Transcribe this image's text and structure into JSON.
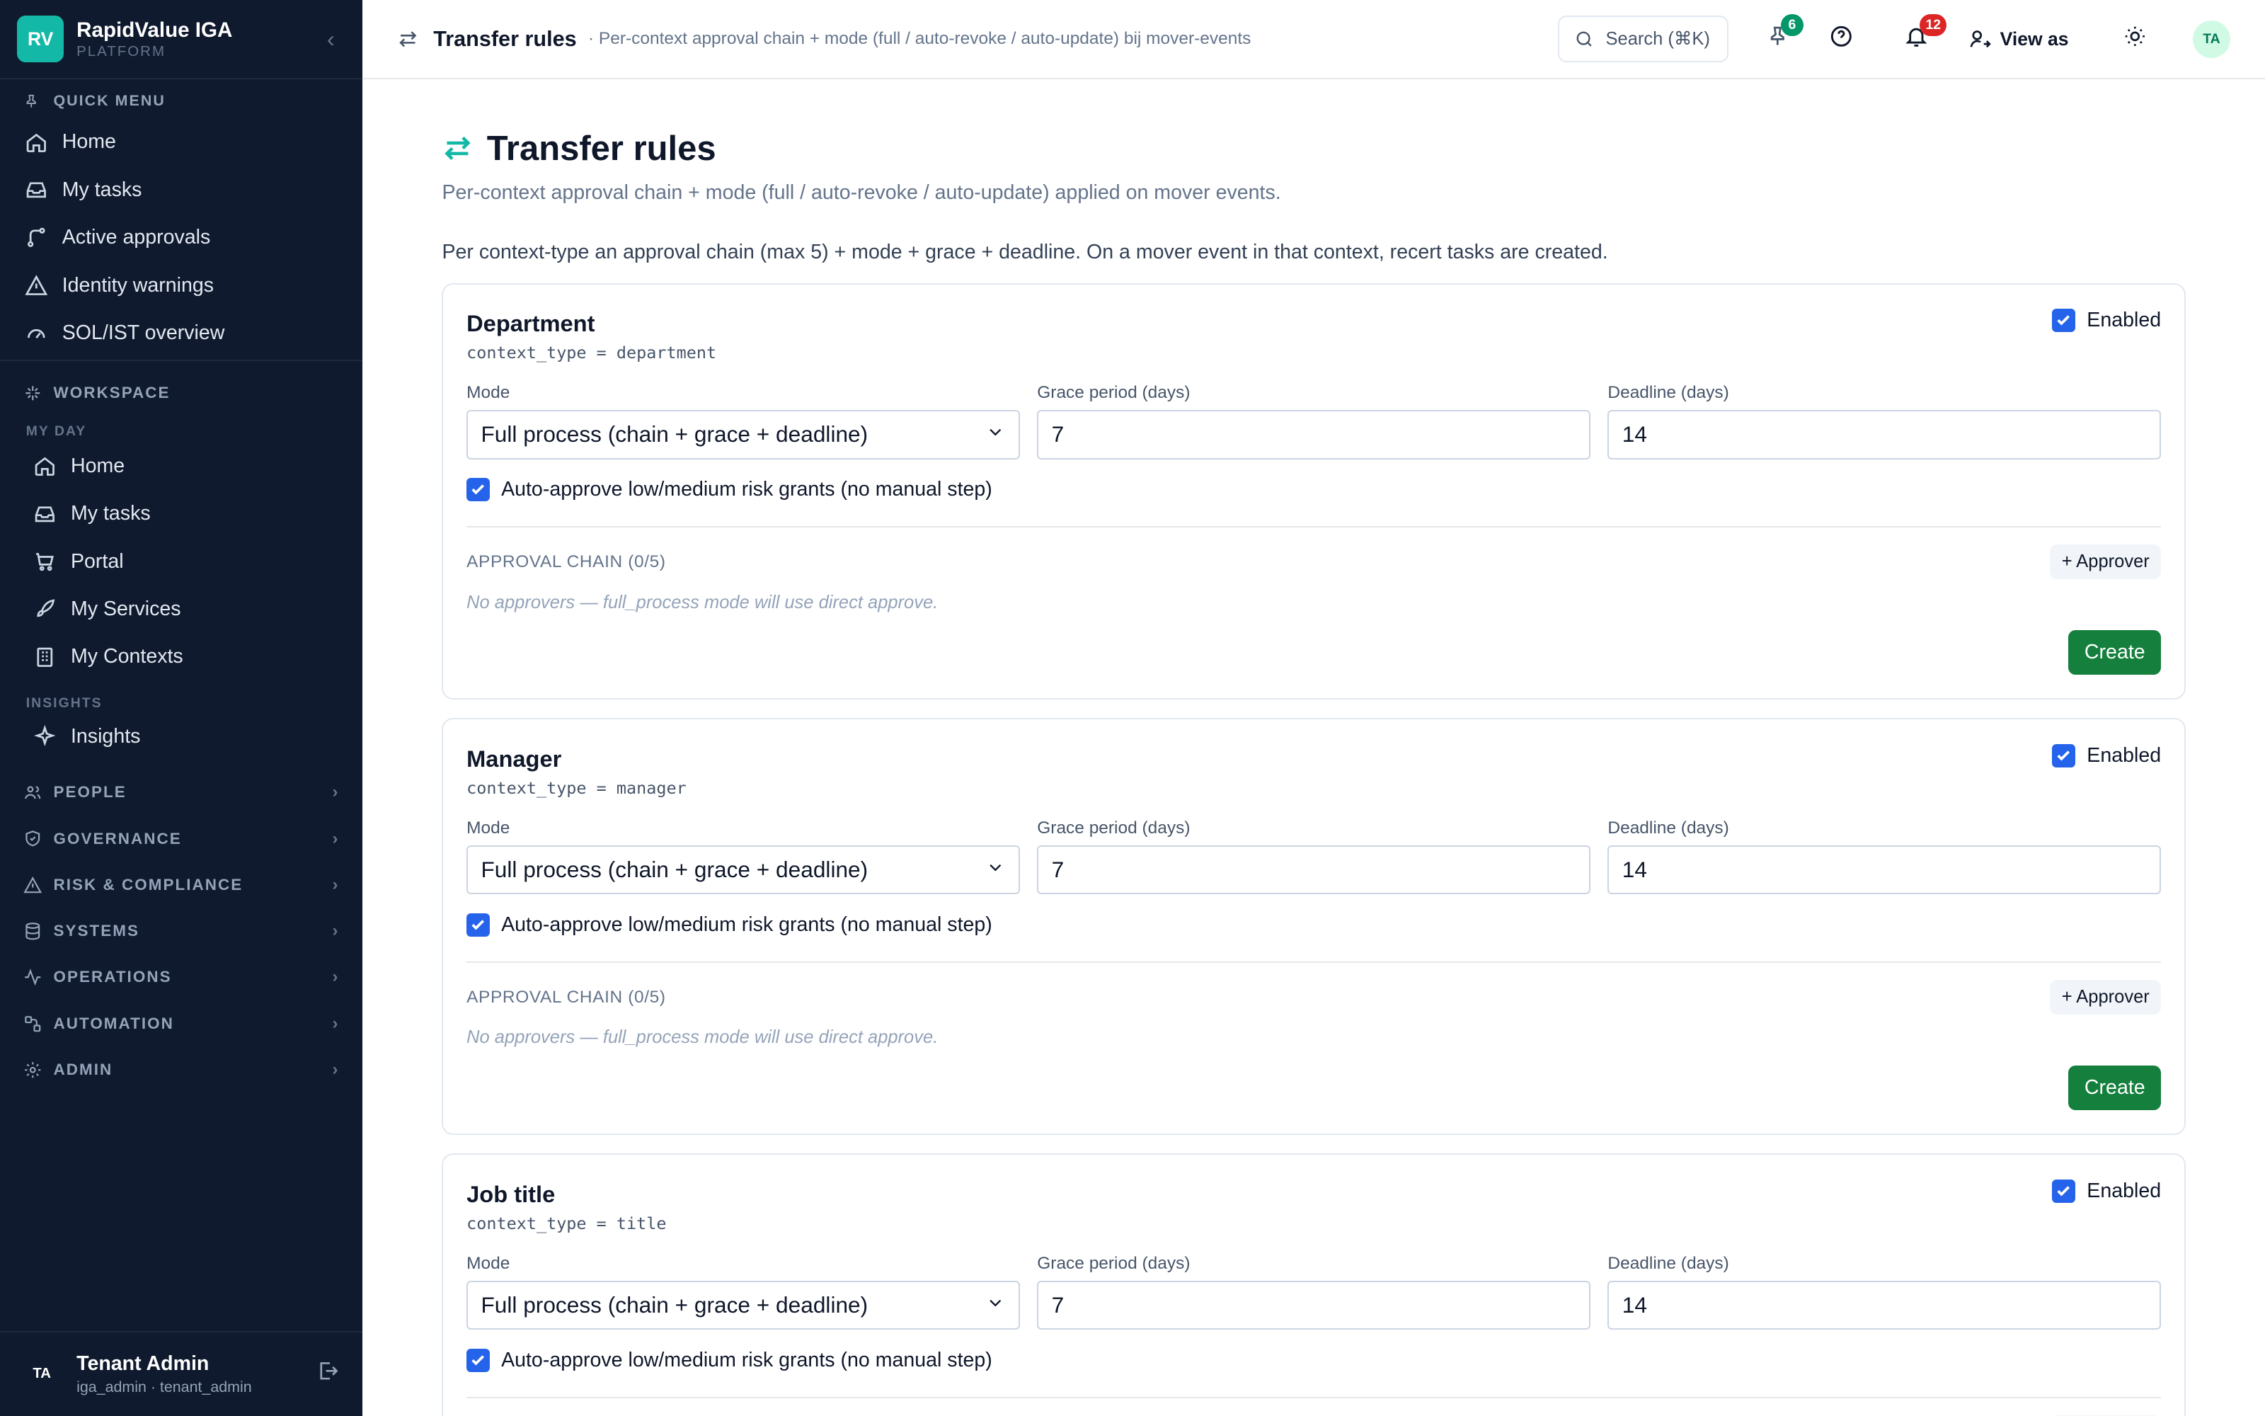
{
  "brand": {
    "logo": "RV",
    "name": "RapidValue IGA",
    "sub": "PLATFORM",
    "logo_color": "#14b8a6"
  },
  "sidebar": {
    "quick_menu_label": "QUICK MENU",
    "quick": [
      {
        "label": "Home",
        "icon": "home-icon"
      },
      {
        "label": "My tasks",
        "icon": "inbox-icon"
      },
      {
        "label": "Active approvals",
        "icon": "flow-icon"
      },
      {
        "label": "Identity warnings",
        "icon": "warning-icon"
      },
      {
        "label": "SOL/IST overview",
        "icon": "gauge-icon"
      }
    ],
    "workspace_label": "WORKSPACE",
    "my_day_label": "MY DAY",
    "my_day": [
      {
        "label": "Home",
        "icon": "home-icon"
      },
      {
        "label": "My tasks",
        "icon": "inbox-icon"
      },
      {
        "label": "Portal",
        "icon": "cart-icon"
      },
      {
        "label": "My Services",
        "icon": "rocket-icon"
      },
      {
        "label": "My Contexts",
        "icon": "building-icon"
      }
    ],
    "insights_label": "INSIGHTS",
    "insights": [
      {
        "label": "Insights",
        "icon": "sparkle-icon"
      }
    ],
    "groups": [
      {
        "label": "PEOPLE",
        "icon": "users-icon"
      },
      {
        "label": "GOVERNANCE",
        "icon": "shield-icon"
      },
      {
        "label": "RISK & COMPLIANCE",
        "icon": "warning-icon"
      },
      {
        "label": "SYSTEMS",
        "icon": "database-icon"
      },
      {
        "label": "OPERATIONS",
        "icon": "activity-icon"
      },
      {
        "label": "AUTOMATION",
        "icon": "workflow-icon"
      },
      {
        "label": "ADMIN",
        "icon": "gear-icon"
      }
    ],
    "user": {
      "initials": "TA",
      "name": "Tenant Admin",
      "sub": "iga_admin · tenant_admin"
    }
  },
  "topbar": {
    "title": "Transfer rules",
    "subtitle": "· Per-context approval chain + mode (full / auto-revoke / auto-update) bij mover-events",
    "search": "Search (⌘K)",
    "pin_badge": "6",
    "notif_badge": "12",
    "view_as": "View as",
    "avatar": "TA",
    "pin_badge_color": "#059669",
    "notif_badge_color": "#dc2626"
  },
  "page": {
    "title": "Transfer rules",
    "description": "Per-context approval chain + mode (full / auto-revoke / auto-update) applied on mover events.",
    "note": "Per context-type an approval chain (max 5) + mode + grace + deadline. On a mover event in that context, recert tasks are created."
  },
  "labels": {
    "enabled": "Enabled",
    "mode": "Mode",
    "grace": "Grace period (days)",
    "deadline": "Deadline (days)",
    "auto_approve": "Auto-approve low/medium risk grants (no manual step)",
    "chain": "APPROVAL CHAIN (0/5)",
    "add_approver": "+ Approver",
    "no_approvers": "No approvers — full_process mode will use direct approve.",
    "create": "Create"
  },
  "rules": [
    {
      "title": "Department",
      "context": "context_type = department",
      "mode": "Full process (chain + grace + deadline)",
      "grace": "7",
      "deadline": "14",
      "enabled": true,
      "auto_approve": true
    },
    {
      "title": "Manager",
      "context": "context_type = manager",
      "mode": "Full process (chain + grace + deadline)",
      "grace": "7",
      "deadline": "14",
      "enabled": true,
      "auto_approve": true
    },
    {
      "title": "Job title",
      "context": "context_type = title",
      "mode": "Full process (chain + grace + deadline)",
      "grace": "7",
      "deadline": "14",
      "enabled": true,
      "auto_approve": true
    }
  ],
  "colors": {
    "sidebar_bg": "#0f1a2e",
    "accent": "#14b8a6",
    "create_btn": "#15803d",
    "checkbox": "#2563eb"
  }
}
